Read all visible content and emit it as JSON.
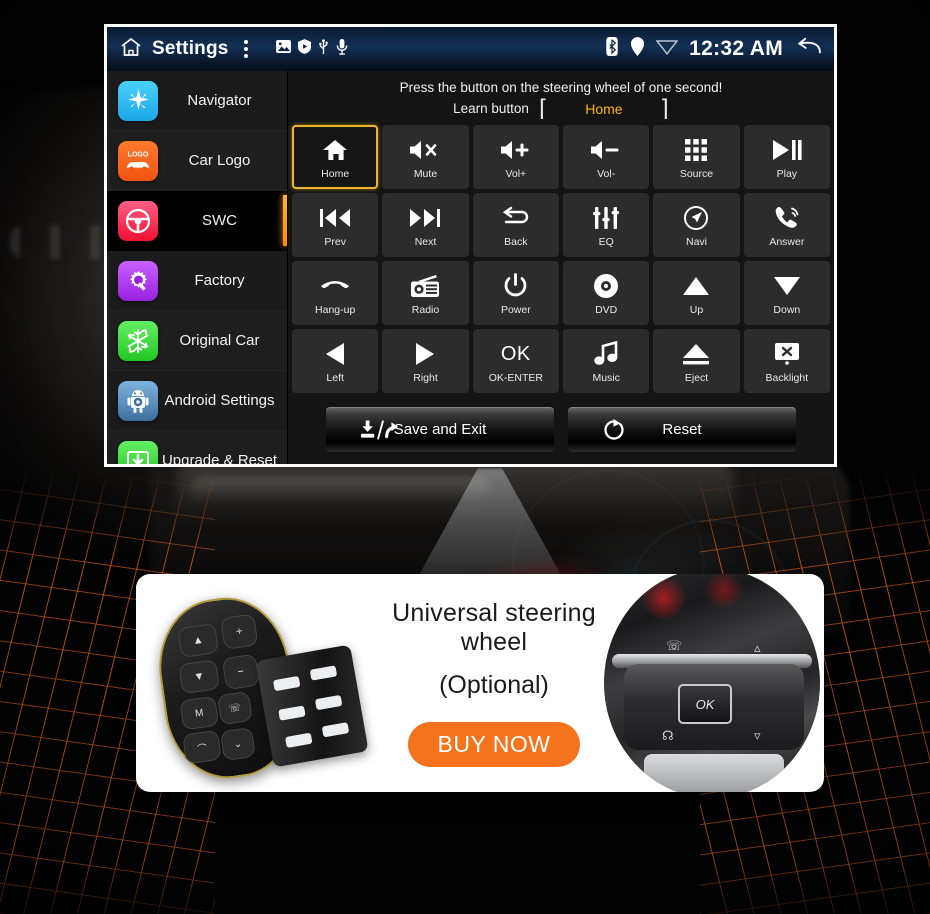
{
  "statusbar": {
    "title": "Settings",
    "home_icon": "home-icon",
    "overflow_icon": "kebab-menu-icon",
    "indicators": [
      "image-icon",
      "location-shield-icon",
      "usb-icon",
      "microphone-icon"
    ],
    "bluetooth_icon": "bluetooth-icon",
    "gps_icon": "gps-pin-icon",
    "wifi_icon": "wifi-icon",
    "time": "12:32 AM",
    "back_icon": "back-arrow-icon"
  },
  "sidebar": {
    "items": [
      {
        "label": "Navigator",
        "icon": "compass-icon",
        "color": "#29b6f6",
        "active": false
      },
      {
        "label": "Car Logo",
        "icon": "car-logo-icon",
        "color": "#f4601a",
        "active": false
      },
      {
        "label": "SWC",
        "icon": "steering-wheel-icon",
        "color": "#f0315c",
        "active": true
      },
      {
        "label": "Factory",
        "icon": "gear-wrench-icon",
        "color": "#b23cf0",
        "active": false
      },
      {
        "label": "Original Car",
        "icon": "snowflake-icon",
        "color": "#3ddb3d",
        "active": false
      },
      {
        "label": "Android Settings",
        "icon": "android-robot-icon",
        "color": "#4d8bc9",
        "active": false
      },
      {
        "label": "Upgrade & Reset",
        "icon": "download-box-icon",
        "color": "#3ddb3d",
        "active": false
      }
    ]
  },
  "main": {
    "hint": "Press the button on the steering wheel of one second!",
    "learn_label": "Learn button",
    "learn_bracket_left": "⌈",
    "learn_bracket_right": "⌉",
    "learn_value": "Home",
    "learn_value_color": "#ffb400",
    "selected_button": "Home",
    "buttons": [
      {
        "label": "Home",
        "icon": "home-icon",
        "selected": true
      },
      {
        "label": "Mute",
        "icon": "speaker-mute-icon",
        "selected": false
      },
      {
        "label": "Vol+",
        "icon": "volume-up-icon",
        "selected": false
      },
      {
        "label": "Vol-",
        "icon": "volume-down-icon",
        "selected": false
      },
      {
        "label": "Source",
        "icon": "grid-apps-icon",
        "selected": false
      },
      {
        "label": "Play",
        "icon": "play-pause-icon",
        "selected": false
      },
      {
        "label": "Prev",
        "icon": "previous-track-icon",
        "selected": false
      },
      {
        "label": "Next",
        "icon": "next-track-icon",
        "selected": false
      },
      {
        "label": "Back",
        "icon": "back-undo-icon",
        "selected": false
      },
      {
        "label": "EQ",
        "icon": "equalizer-icon",
        "selected": false
      },
      {
        "label": "Navi",
        "icon": "navigation-arrow-icon",
        "selected": false
      },
      {
        "label": "Answer",
        "icon": "phone-answer-icon",
        "selected": false
      },
      {
        "label": "Hang-up",
        "icon": "phone-hangup-icon",
        "selected": false
      },
      {
        "label": "Radio",
        "icon": "radio-icon",
        "selected": false
      },
      {
        "label": "Power",
        "icon": "power-icon",
        "selected": false
      },
      {
        "label": "DVD",
        "icon": "disc-icon",
        "selected": false
      },
      {
        "label": "Up",
        "icon": "triangle-up-icon",
        "selected": false
      },
      {
        "label": "Down",
        "icon": "triangle-down-icon",
        "selected": false
      },
      {
        "label": "Left",
        "icon": "triangle-left-icon",
        "selected": false
      },
      {
        "label": "Right",
        "icon": "triangle-right-icon",
        "selected": false
      },
      {
        "label": "OK-ENTER",
        "icon": "ok-text-icon",
        "selected": false,
        "glyph": "OK"
      },
      {
        "label": "Music",
        "icon": "music-note-icon",
        "selected": false
      },
      {
        "label": "Eject",
        "icon": "eject-icon",
        "selected": false
      },
      {
        "label": "Backlight",
        "icon": "backlight-screen-icon",
        "selected": false
      }
    ],
    "actions": [
      {
        "label": "Save and Exit",
        "icon": "save-export-icon"
      },
      {
        "label": "Reset",
        "icon": "refresh-icon"
      }
    ]
  },
  "ad": {
    "line1": "Universal steering wheel",
    "line2": "(Optional)",
    "cta": "BUY NOW",
    "cta_color": "#f4731c",
    "left_image": "universal-remote-fob-image",
    "right_image": "car-steering-wheel-buttons-photo",
    "wheel_ok_label": "OK"
  }
}
